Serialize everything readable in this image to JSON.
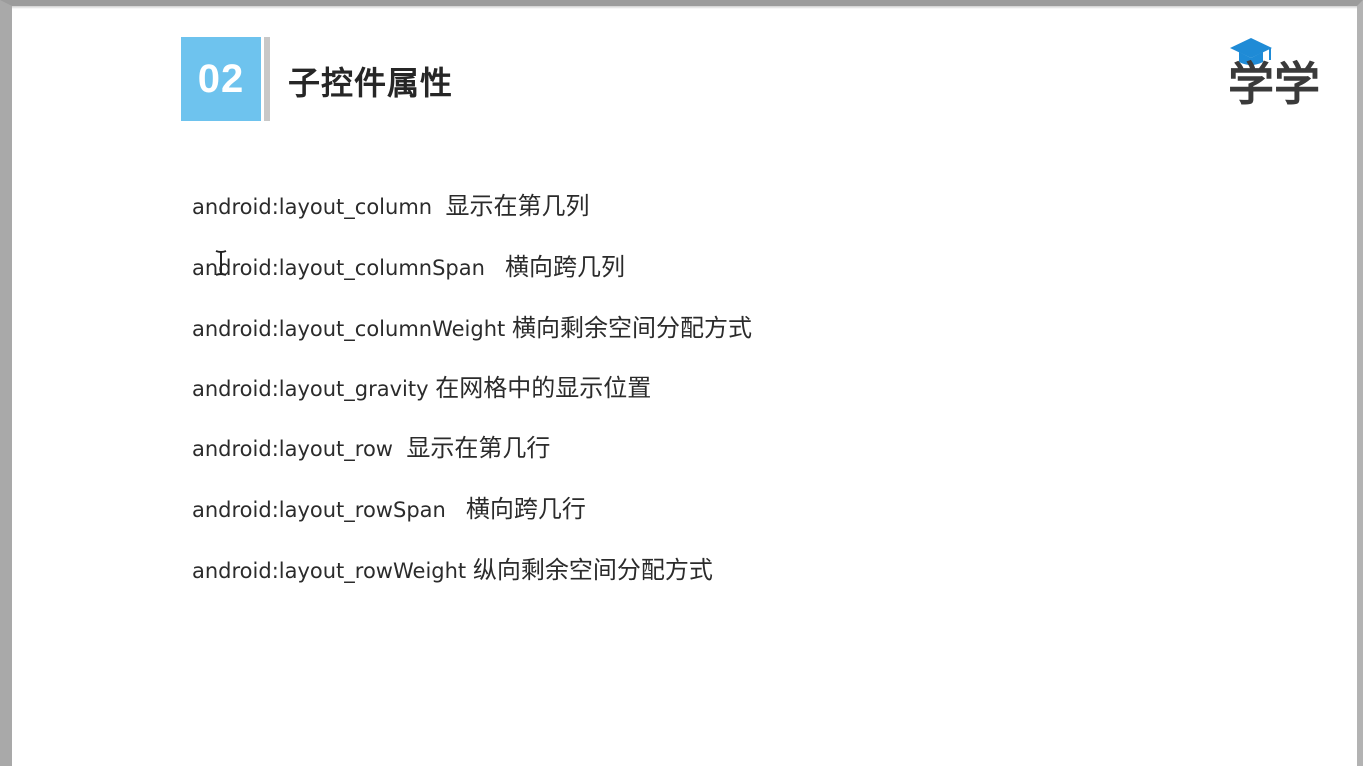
{
  "section": {
    "number": "02",
    "title": "子控件属性"
  },
  "logo": {
    "text": "学学",
    "name": "graduation-cap-logo"
  },
  "properties": [
    {
      "key": "android:layout_column",
      "sep": "  ",
      "desc": "显示在第几列"
    },
    {
      "key": "android:layout_columnSpan",
      "sep": "   ",
      "desc": "横向跨几列"
    },
    {
      "key": "android:layout_columnWeight",
      "sep": " ",
      "desc": "横向剩余空间分配方式"
    },
    {
      "key": "android:layout_gravity",
      "sep": " ",
      "desc": "在网格中的显示位置"
    },
    {
      "key": "android:layout_row",
      "sep": "  ",
      "desc": "显示在第几行"
    },
    {
      "key": "android:layout_rowSpan",
      "sep": "   ",
      "desc": "横向跨几行"
    },
    {
      "key": "android:layout_rowWeight",
      "sep": " ",
      "desc": "纵向剩余空间分配方式"
    }
  ],
  "colors": {
    "accent": "#6ec3ee",
    "divider": "#c8c8c8",
    "text": "#2b2b2b",
    "logo_cap": "#1f8bd6",
    "logo_text": "#3a3a3a"
  }
}
